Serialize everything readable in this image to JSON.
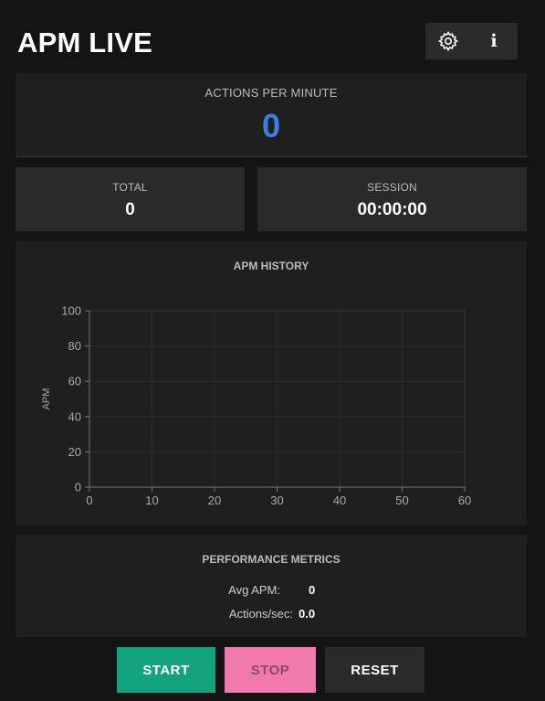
{
  "app": {
    "title": "APM LIVE"
  },
  "toolbar": {
    "settings_icon": "gear-icon",
    "info_icon": "info-icon",
    "info_glyph": "i"
  },
  "apm": {
    "label": "ACTIONS PER MINUTE",
    "value": "0",
    "value_color": "#3d7fe0"
  },
  "stats": {
    "total": {
      "label": "TOTAL",
      "value": "0"
    },
    "session": {
      "label": "SESSION",
      "value": "00:00:00"
    }
  },
  "chart": {
    "title": "APM HISTORY"
  },
  "chart_data": {
    "type": "line",
    "title": "APM HISTORY",
    "xlabel": "",
    "ylabel": "APM",
    "xlim": [
      0,
      60
    ],
    "ylim": [
      0,
      100
    ],
    "x_ticks": [
      0,
      10,
      20,
      30,
      40,
      50,
      60
    ],
    "y_ticks": [
      0,
      20,
      40,
      60,
      80,
      100
    ],
    "grid": true,
    "series": []
  },
  "metrics": {
    "title": "PERFORMANCE METRICS",
    "avg_label": "Avg APM:",
    "avg_value": "0",
    "aps_label": "Actions/sec:",
    "aps_value": "0.0"
  },
  "controls": {
    "start_label": "START",
    "stop_label": "STOP",
    "reset_label": "RESET"
  },
  "colors": {
    "start": "#12a27c",
    "stop": "#f279ac",
    "reset": "#2a2a2a",
    "accent": "#3d7fe0"
  }
}
